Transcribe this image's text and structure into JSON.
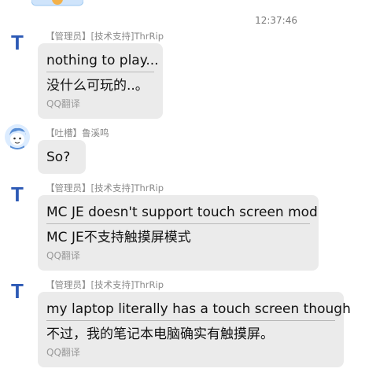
{
  "chat": {
    "timestamp": "12:37:46",
    "messages": [
      {
        "avatar_letter": "T",
        "sender": "【管理员】[技术支持]ThrRip",
        "text": "nothing to play...",
        "translation": "没什么可玩的..。",
        "translation_label": "QQ翻译"
      },
      {
        "sender": "【吐槽】鲁溪鸣",
        "text": "So?"
      },
      {
        "avatar_letter": "T",
        "sender": "【管理员】[技术支持]ThrRip",
        "text": "MC JE doesn't support touch screen mod",
        "translation": "MC JE不支持触摸屏模式",
        "translation_label": "QQ翻译"
      },
      {
        "avatar_letter": "T",
        "sender": "【管理员】[技术支持]ThrRip",
        "text": "my laptop literally has a touch screen though",
        "translation": "不过，我的笔记本电脑确实有触摸屏。",
        "translation_label": "QQ翻译"
      }
    ]
  }
}
